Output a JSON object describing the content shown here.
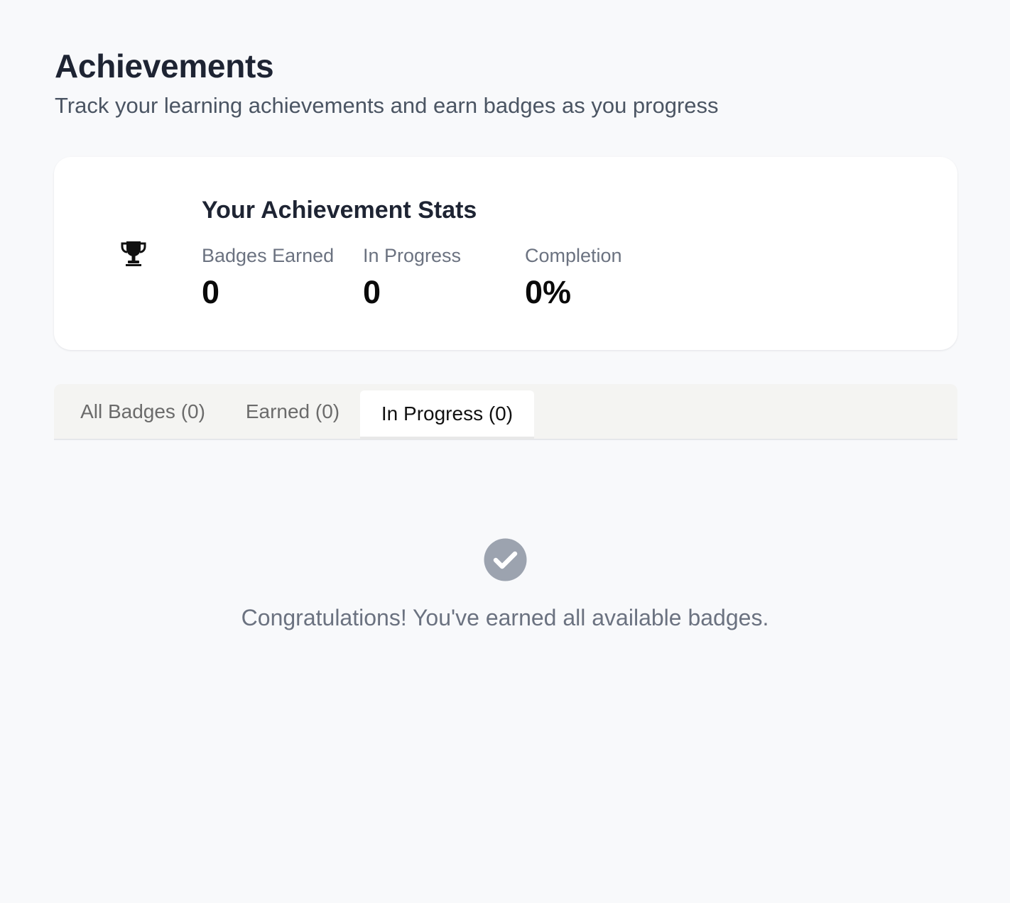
{
  "header": {
    "title": "Achievements",
    "subtitle": "Track your learning achievements and earn badges as you progress"
  },
  "stats": {
    "icon": "trophy-icon",
    "title": "Your Achievement Stats",
    "badges_earned": {
      "label": "Badges Earned",
      "value": "0"
    },
    "in_progress": {
      "label": "In Progress",
      "value": "0"
    },
    "completion": {
      "label": "Completion",
      "value": "0%"
    }
  },
  "tabs": {
    "active": "In Progress (0)",
    "items": [
      {
        "label": "All Badges (0)"
      },
      {
        "label": "Earned (0)"
      },
      {
        "label": "In Progress (0)"
      }
    ]
  },
  "empty_state": {
    "icon": "check-circle-icon",
    "message": "Congratulations! You've earned all available badges."
  },
  "colors": {
    "background": "#f8f9fb",
    "card": "#ffffff",
    "tab_bar": "#f4f4f2",
    "muted_text": "#6b7280",
    "check_circle": "#9ca3af"
  }
}
